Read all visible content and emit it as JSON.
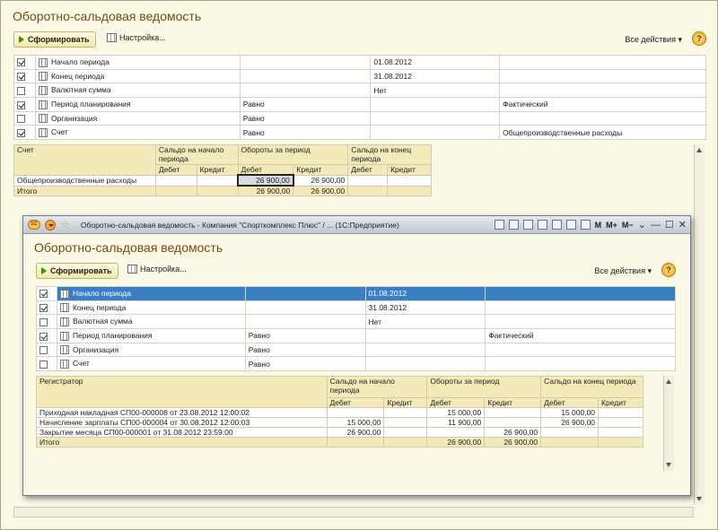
{
  "main": {
    "title": "Оборотно-сальдовая ведомость",
    "generate_label": "Сформировать",
    "settings_label": "Настройка...",
    "all_actions_label": "Все действия",
    "help_label": "?",
    "params": [
      {
        "checked": true,
        "name": "Начало периода",
        "c2": "",
        "c3": "01.08.2012",
        "c4": ""
      },
      {
        "checked": true,
        "name": "Конец периода",
        "c2": "",
        "c3": "31.08.2012",
        "c4": ""
      },
      {
        "checked": false,
        "name": "Валютная сумма",
        "c2": "",
        "c3": "Нет",
        "c4": ""
      },
      {
        "checked": true,
        "name": "Период планирования",
        "c2": "Равно",
        "c3": "",
        "c4": "Фактический"
      },
      {
        "checked": false,
        "name": "Организация",
        "c2": "Равно",
        "c3": "",
        "c4": ""
      },
      {
        "checked": true,
        "name": "Счет",
        "c2": "Равно",
        "c3": "",
        "c4": "Общепроизводственные расходы"
      }
    ],
    "report": {
      "col_account": "Счет",
      "col_start": "Сальдо на начало периода",
      "col_turn": "Обороты за период",
      "col_end": "Сальдо на конец периода",
      "debit": "Дебет",
      "credit": "Кредит",
      "row_name": "Общепроизводственные расходы",
      "row_turn_debit": "26 900,00",
      "row_turn_credit": "26 900,00",
      "total_label": "Итого",
      "total_turn_debit": "26 900,00",
      "total_turn_credit": "26 900,00"
    }
  },
  "window": {
    "caption": "Оборотно-сальдовая ведомость - Компания \"Спорткомплекс Плюс\" / ... (1С:Предприятие)",
    "logo_text": "1С",
    "tb_m": "M",
    "tb_mplus": "M+",
    "tb_mminus": "M−",
    "title": "Оборотно-сальдовая ведомость",
    "generate_label": "Сформировать",
    "settings_label": "Настройка...",
    "all_actions_label": "Все действия",
    "help_label": "?",
    "params": [
      {
        "checked": true,
        "name": "Начало периода",
        "c2": "",
        "c3": "01.08.2012",
        "c4": ""
      },
      {
        "checked": true,
        "name": "Конец периода",
        "c2": "",
        "c3": "31.08.2012",
        "c4": ""
      },
      {
        "checked": false,
        "name": "Валютная сумма",
        "c2": "",
        "c3": "Нет",
        "c4": ""
      },
      {
        "checked": true,
        "name": "Период планирования",
        "c2": "Равно",
        "c3": "",
        "c4": "Фактический"
      },
      {
        "checked": false,
        "name": "Организация",
        "c2": "Равно",
        "c3": "",
        "c4": ""
      },
      {
        "checked": false,
        "name": "Счет",
        "c2": "Равно",
        "c3": "",
        "c4": ""
      }
    ],
    "report": {
      "col_reg": "Регистратор",
      "col_start": "Сальдо на начало периода",
      "col_turn": "Обороты за период",
      "col_end": "Сальдо на конец периода",
      "debit": "Дебет",
      "credit": "Кредит",
      "rows": [
        {
          "name": "Приходная накладная СП00-000008 от 23.08.2012 12:00:02",
          "sd": "",
          "sc": "",
          "td": "15 000,00",
          "tc": "",
          "ed": "15 000,00",
          "ec": ""
        },
        {
          "name": "Начисление зарплаты СП00-000004 от 30.08.2012 12:00:03",
          "sd": "15 000,00",
          "sc": "",
          "td": "11 900,00",
          "tc": "",
          "ed": "26 900,00",
          "ec": ""
        },
        {
          "name": "Закрытие месяца СП00-000001 от 31.08.2012 23:59:00",
          "sd": "26 900,00",
          "sc": "",
          "td": "",
          "tc": "26 900,00",
          "ed": "",
          "ec": ""
        }
      ],
      "total_label": "Итого",
      "total_turn_debit": "26 900,00",
      "total_turn_credit": "26 900,00"
    }
  }
}
